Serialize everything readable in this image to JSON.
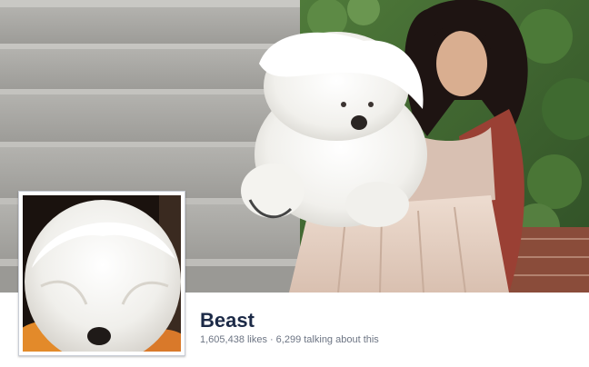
{
  "page": {
    "name": "Beast",
    "likes_text": "1,605,438 likes",
    "separator": "·",
    "talking_text": "6,299 talking about this"
  },
  "cover_photo": {
    "subject": "woman holding a white fluffy dog in front of stone steps and ivy"
  },
  "profile_picture": {
    "subject": "close-up of white fluffy dog"
  },
  "colors": {
    "page_name": "#1c2a47",
    "stats_text": "#6d7584",
    "frame_border": "#c9cdd6"
  }
}
